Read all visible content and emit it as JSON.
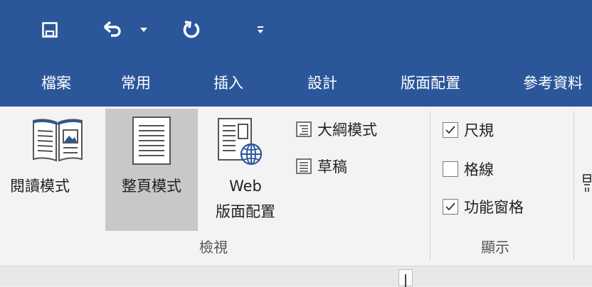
{
  "tabs": [
    {
      "label": "檔案"
    },
    {
      "label": "常用"
    },
    {
      "label": "插入"
    },
    {
      "label": "設計"
    },
    {
      "label": "版面配置"
    },
    {
      "label": "參考資料"
    }
  ],
  "view_group": {
    "label": "檢視",
    "read_mode": "閱讀模式",
    "print_layout": "整頁模式",
    "web_layout_line1": "Web",
    "web_layout_line2": "版面配置",
    "outline": "大綱模式",
    "draft": "草稿"
  },
  "show_group": {
    "label": "顯示",
    "ruler": {
      "label": "尺規",
      "checked": true
    },
    "gridlines": {
      "label": "格線",
      "checked": false
    },
    "nav_pane": {
      "label": "功能窗格",
      "checked": true
    }
  },
  "colors": {
    "title_bar": "#2b579a",
    "active_button": "#c8c8c8"
  }
}
